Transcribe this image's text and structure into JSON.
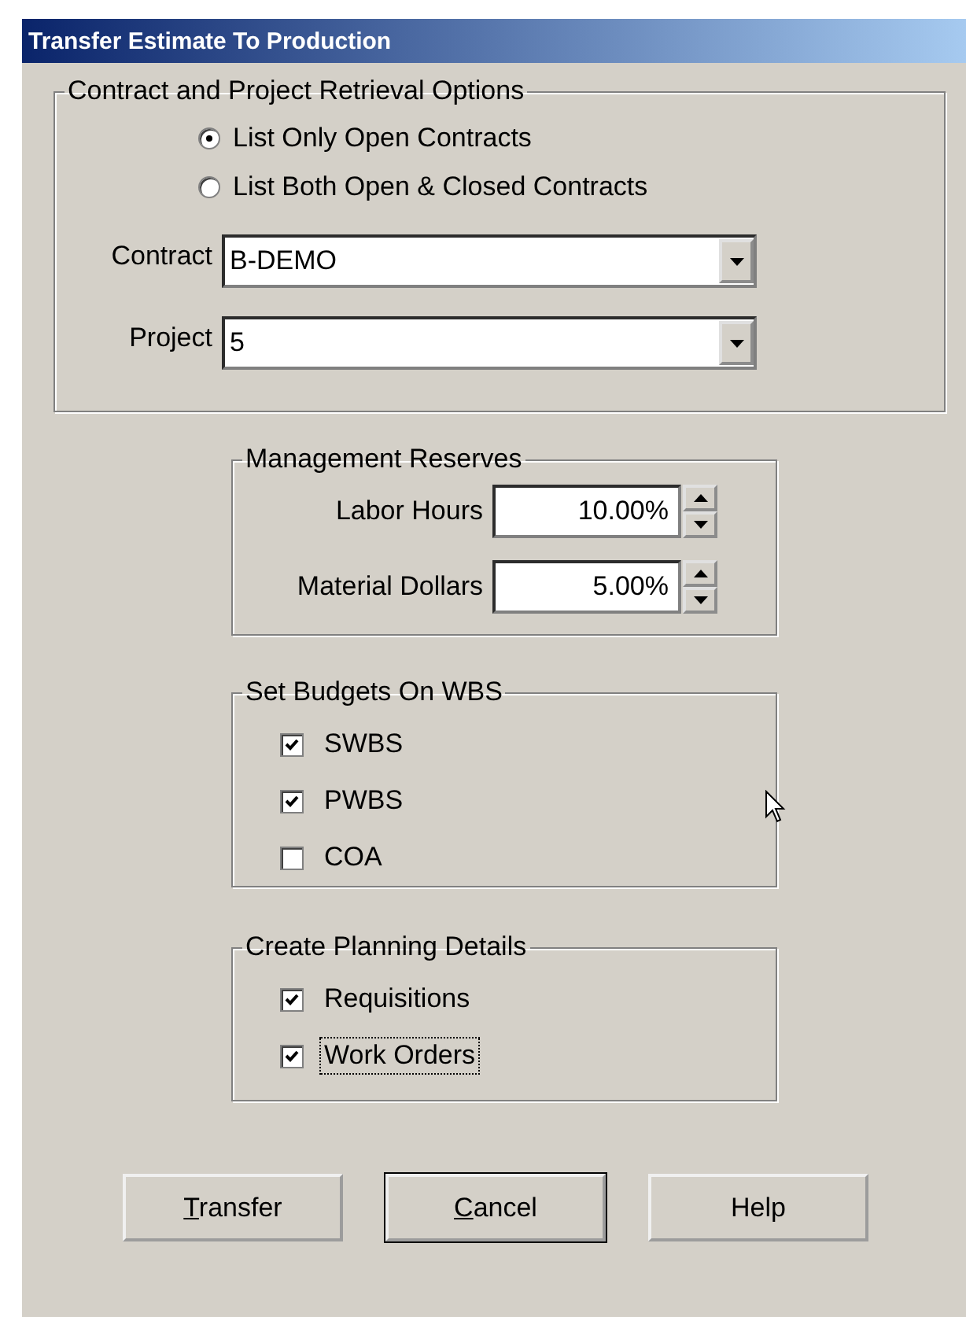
{
  "window": {
    "title": "Transfer Estimate To Production"
  },
  "retrieval": {
    "title": "Contract and Project Retrieval Options",
    "options": [
      {
        "label": "List Only Open Contracts",
        "selected": true
      },
      {
        "label": "List Both Open & Closed Contracts",
        "selected": false
      }
    ],
    "fields": [
      {
        "label": "Contract",
        "value": "B-DEMO"
      },
      {
        "label": "Project",
        "value": "5"
      }
    ]
  },
  "reserves": {
    "title": "Management Reserves",
    "fields": [
      {
        "label": "Labor Hours",
        "value": "10.00%"
      },
      {
        "label": "Material Dollars",
        "value": "5.00%"
      }
    ]
  },
  "budgets": {
    "title": "Set Budgets On WBS",
    "items": [
      {
        "label": "SWBS",
        "checked": true,
        "focused": false
      },
      {
        "label": "PWBS",
        "checked": true,
        "focused": false
      },
      {
        "label": "COA",
        "checked": false,
        "focused": false
      }
    ]
  },
  "planning": {
    "title": "Create Planning Details",
    "items": [
      {
        "label": "Requisitions",
        "checked": true,
        "focused": false
      },
      {
        "label": "Work Orders",
        "checked": true,
        "focused": true
      }
    ]
  },
  "buttons": [
    {
      "key": "T",
      "rest": "ransfer",
      "default": false
    },
    {
      "key": "C",
      "rest": "ancel",
      "default": true
    },
    {
      "rest": "Help",
      "default": false
    }
  ]
}
